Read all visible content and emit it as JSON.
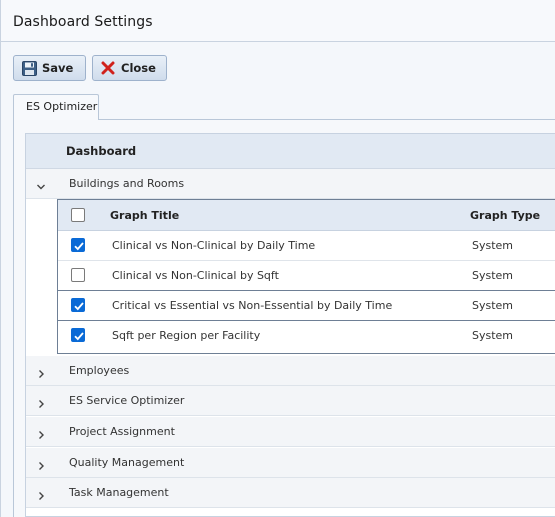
{
  "window": {
    "title": "Dashboard Settings"
  },
  "toolbar": {
    "save_label": "Save",
    "close_label": "Close"
  },
  "tabs": [
    {
      "label": "ES Optimizer",
      "active": true
    }
  ],
  "grid": {
    "header": "Dashboard",
    "groups": [
      {
        "label": "Buildings and Rooms",
        "expanded": true
      },
      {
        "label": "Employees",
        "expanded": false
      },
      {
        "label": "ES Service Optimizer",
        "expanded": false
      },
      {
        "label": "Project Assignment",
        "expanded": false
      },
      {
        "label": "Quality Management",
        "expanded": false
      },
      {
        "label": "Task Management",
        "expanded": false
      }
    ],
    "subgrid": {
      "columns": {
        "title": "Graph Title",
        "type": "Graph Type"
      },
      "select_all_checked": false,
      "rows": [
        {
          "title": "Clinical vs Non-Clinical by Daily Time",
          "type": "System",
          "checked": true
        },
        {
          "title": "Clinical vs Non-Clinical by Sqft",
          "type": "System",
          "checked": false
        },
        {
          "title": "Critical vs Essential vs Non-Essential by Daily Time",
          "type": "System",
          "checked": true
        },
        {
          "title": "Sqft per Region per Facility",
          "type": "System",
          "checked": true
        }
      ]
    }
  },
  "colors": {
    "accent": "#0a6ad6",
    "close_icon": "#d0211c",
    "header_bg": "#e1e9f3"
  }
}
